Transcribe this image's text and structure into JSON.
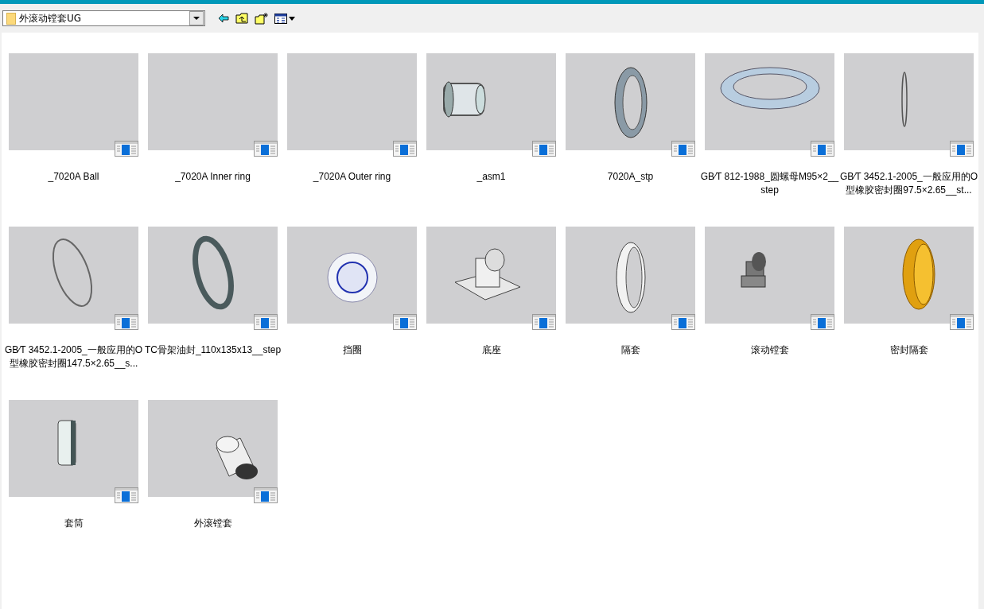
{
  "toolbar": {
    "path": "外滚动镗套UG"
  },
  "files": [
    {
      "name": "_7020A Ball"
    },
    {
      "name": "_7020A Inner ring"
    },
    {
      "name": "_7020A Outer ring"
    },
    {
      "name": "_asm1"
    },
    {
      "name": "7020A_stp"
    },
    {
      "name": "GB∕T 812-1988_圆螺母M95×2__step"
    },
    {
      "name": "GB∕T 3452.1-2005_一般应用的O型橡胶密封圈97.5×2.65__st..."
    },
    {
      "name": "GB∕T 3452.1-2005_一般应用的O型橡胶密封圈147.5×2.65__s..."
    },
    {
      "name": "TC骨架油封_110x135x13__step"
    },
    {
      "name": "挡圈"
    },
    {
      "name": "底座"
    },
    {
      "name": "隔套"
    },
    {
      "name": "滚动镗套"
    },
    {
      "name": "密封隔套"
    },
    {
      "name": "套筒"
    },
    {
      "name": "外滚镗套"
    }
  ]
}
